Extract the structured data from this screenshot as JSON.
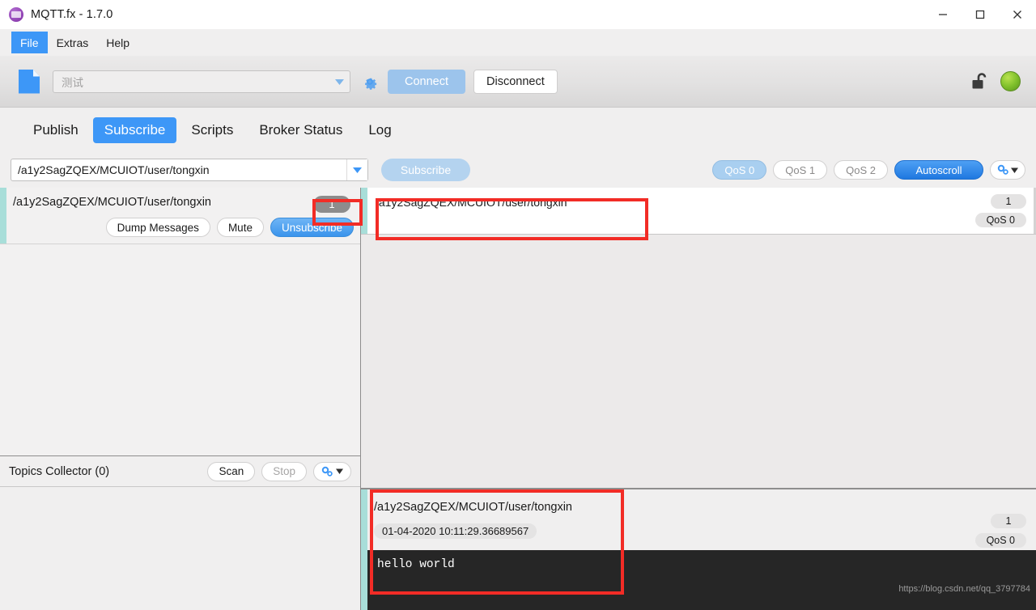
{
  "window": {
    "title": "MQTT.fx - 1.7.0",
    "app_icon": "mqtt-logo-icon",
    "minimize_label": "minimize-icon",
    "maximize_label": "maximize-icon",
    "close_label": "close-icon"
  },
  "menubar": {
    "items": [
      {
        "label": "File",
        "active": true
      },
      {
        "label": "Extras",
        "active": false
      },
      {
        "label": "Help",
        "active": false
      }
    ]
  },
  "connection_bar": {
    "profile_icon": "document-icon",
    "profile_value": "测试",
    "profile_placeholder": "测试",
    "settings_icon": "gear-icon",
    "connect_label": "Connect",
    "disconnect_label": "Disconnect",
    "lock_icon": "unlocked-padlock-icon",
    "status_indicator": "green-status-dot",
    "connected_color": "#7fc02b",
    "connect_disabled_color": "#9cc4ec"
  },
  "tabs": [
    {
      "label": "Publish",
      "active": false
    },
    {
      "label": "Subscribe",
      "active": true
    },
    {
      "label": "Scripts",
      "active": false
    },
    {
      "label": "Broker Status",
      "active": false
    },
    {
      "label": "Log",
      "active": false
    }
  ],
  "subscribe_bar": {
    "topic_value": "/a1y2SagZQEX/MCUIOT/user/tongxin",
    "topic_placeholder": "Topic",
    "dropdown_icon": "chevron-down-icon",
    "subscribe_label": "Subscribe",
    "qos_buttons": [
      {
        "label": "QoS 0",
        "selected": true
      },
      {
        "label": "QoS 1",
        "selected": false
      },
      {
        "label": "QoS 2",
        "selected": false
      }
    ],
    "autoscroll_label": "Autoscroll",
    "autoscroll_active": true,
    "options_icon": "gears-dropdown-icon",
    "accent_color": "#1f78e0"
  },
  "subscriptions": [
    {
      "topic": "/a1y2SagZQEX/MCUIOT/user/tongxin",
      "count": "1",
      "accent_color": "#a8ded9",
      "dump_label": "Dump Messages",
      "mute_label": "Mute",
      "unsubscribe_label": "Unsubscribe"
    }
  ],
  "topics_collector": {
    "title": "Topics Collector (0)",
    "scan_label": "Scan",
    "stop_label": "Stop",
    "stop_disabled": true,
    "options_icon": "gears-dropdown-icon"
  },
  "messages": [
    {
      "topic": "/a1y2SagZQEX/MCUIOT/user/tongxin",
      "index": "1",
      "qos": "QoS 0"
    }
  ],
  "message_detail": {
    "topic": "/a1y2SagZQEX/MCUIOT/user/tongxin",
    "timestamp": "01-04-2020  10:11:29.36689567",
    "index": "1",
    "qos": "QoS 0",
    "payload": "hello world",
    "payload_bg": "#262626",
    "watermark": "https://blog.csdn.net/qq_3797784"
  },
  "annotations": {
    "color": "#f22c26",
    "boxes": [
      {
        "name": "subscription-count-highlight"
      },
      {
        "name": "message-topic-highlight"
      },
      {
        "name": "message-detail-highlight"
      }
    ]
  }
}
